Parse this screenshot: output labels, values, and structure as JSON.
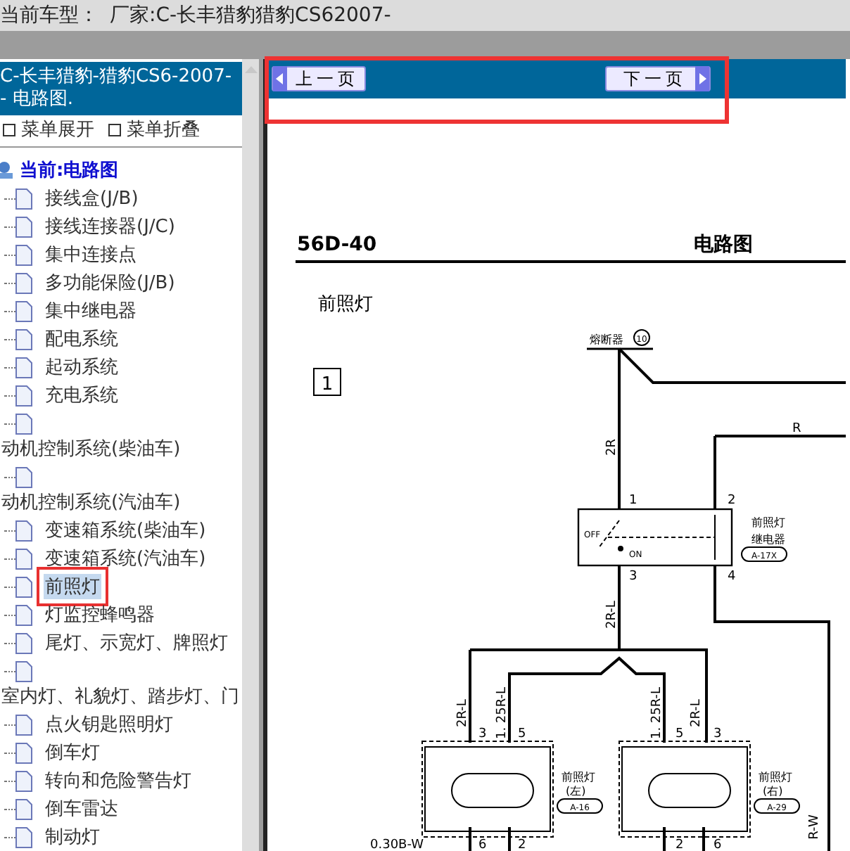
{
  "title_bar": {
    "label": "当前车型：",
    "value": "厂家:C-长丰猎豹猎豹CS62007-"
  },
  "sidebar": {
    "header_lines": [
      "C-长丰猎豹-猎豹CS6-2007-",
      "- 电路图."
    ],
    "menu_actions": [
      "菜单展开",
      "菜单折叠"
    ],
    "tree": {
      "label": "当前:电路图",
      "children": [
        {
          "label": "接线盒(J/B)",
          "selected": false,
          "wrapped": false,
          "annotated": false
        },
        {
          "label": "接线连接器(J/C)",
          "selected": false,
          "wrapped": false,
          "annotated": false
        },
        {
          "label": "集中连接点",
          "selected": false,
          "wrapped": false,
          "annotated": false
        },
        {
          "label": "多功能保险(J/B)",
          "selected": false,
          "wrapped": false,
          "annotated": false
        },
        {
          "label": "集中继电器",
          "selected": false,
          "wrapped": false,
          "annotated": false
        },
        {
          "label": "配电系统",
          "selected": false,
          "wrapped": false,
          "annotated": false
        },
        {
          "label": "起动系统",
          "selected": false,
          "wrapped": false,
          "annotated": false
        },
        {
          "label": "充电系统",
          "selected": false,
          "wrapped": false,
          "annotated": false
        },
        {
          "label": "动机控制系统(柴油车)",
          "selected": false,
          "wrapped": true,
          "annotated": false
        },
        {
          "label": "动机控制系统(汽油车)",
          "selected": false,
          "wrapped": true,
          "annotated": false
        },
        {
          "label": "变速箱系统(柴油车)",
          "selected": false,
          "wrapped": false,
          "annotated": false
        },
        {
          "label": "变速箱系统(汽油车)",
          "selected": false,
          "wrapped": false,
          "annotated": false
        },
        {
          "label": "前照灯",
          "selected": true,
          "wrapped": false,
          "annotated": true
        },
        {
          "label": "灯监控蜂鸣器",
          "selected": false,
          "wrapped": false,
          "annotated": false
        },
        {
          "label": "尾灯、示宽灯、牌照灯",
          "selected": false,
          "wrapped": false,
          "annotated": false
        },
        {
          "label": "室内灯、礼貌灯、踏步灯、门",
          "selected": false,
          "wrapped": true,
          "annotated": false
        },
        {
          "label": "点火钥匙照明灯",
          "selected": false,
          "wrapped": false,
          "annotated": false
        },
        {
          "label": "倒车灯",
          "selected": false,
          "wrapped": false,
          "annotated": false
        },
        {
          "label": "转向和危险警告灯",
          "selected": false,
          "wrapped": false,
          "annotated": false
        },
        {
          "label": "倒车雷达",
          "selected": false,
          "wrapped": false,
          "annotated": false
        },
        {
          "label": "制动灯",
          "selected": false,
          "wrapped": false,
          "annotated": false
        }
      ]
    }
  },
  "nav": {
    "annotated": true,
    "prev": "上一页",
    "next": "下一页"
  },
  "document": {
    "page_code": "56D-40",
    "page_title": "电路图",
    "section_title": "前照灯",
    "figure_number": "1",
    "fuse_label": "熔断器",
    "fuse_number": "10",
    "relay_label": [
      "前照灯",
      "继电器"
    ],
    "relay_code": "A-17X",
    "switch_labels": [
      "OFF",
      "ON"
    ],
    "pins": [
      "1",
      "2",
      "3",
      "4",
      "3",
      "5",
      "5",
      "3",
      "6",
      "2",
      "2",
      "6"
    ],
    "wire_labels": [
      "2R",
      "R",
      "2R-L",
      "2R-L",
      "1. 25R-L",
      "1. 25R-L",
      "2R-L",
      "0.30B-W",
      "R-W"
    ],
    "lamps": [
      {
        "label": "前照灯",
        "side": "(左)",
        "code": "A-16"
      },
      {
        "label": "前照灯",
        "side": "(右)",
        "code": "A-29"
      }
    ]
  }
}
